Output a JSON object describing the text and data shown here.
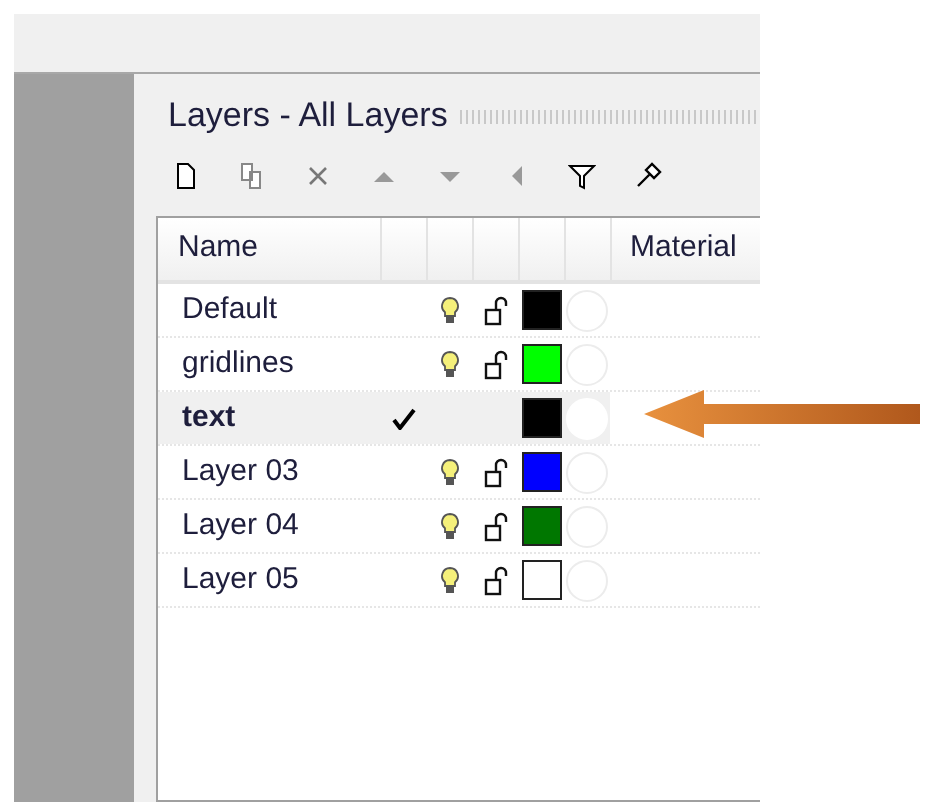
{
  "panel": {
    "title": "Layers - All Layers"
  },
  "table": {
    "columns": [
      "Name",
      "Material"
    ],
    "rows": [
      {
        "name": "Default",
        "current": false,
        "color": "#000000"
      },
      {
        "name": "gridlines",
        "current": false,
        "color": "#00ff00"
      },
      {
        "name": "text",
        "current": true,
        "color": "#000000"
      },
      {
        "name": "Layer 03",
        "current": false,
        "color": "#0000ff"
      },
      {
        "name": "Layer 04",
        "current": false,
        "color": "#007700"
      },
      {
        "name": "Layer 05",
        "current": false,
        "color": "#ffffff"
      }
    ]
  }
}
